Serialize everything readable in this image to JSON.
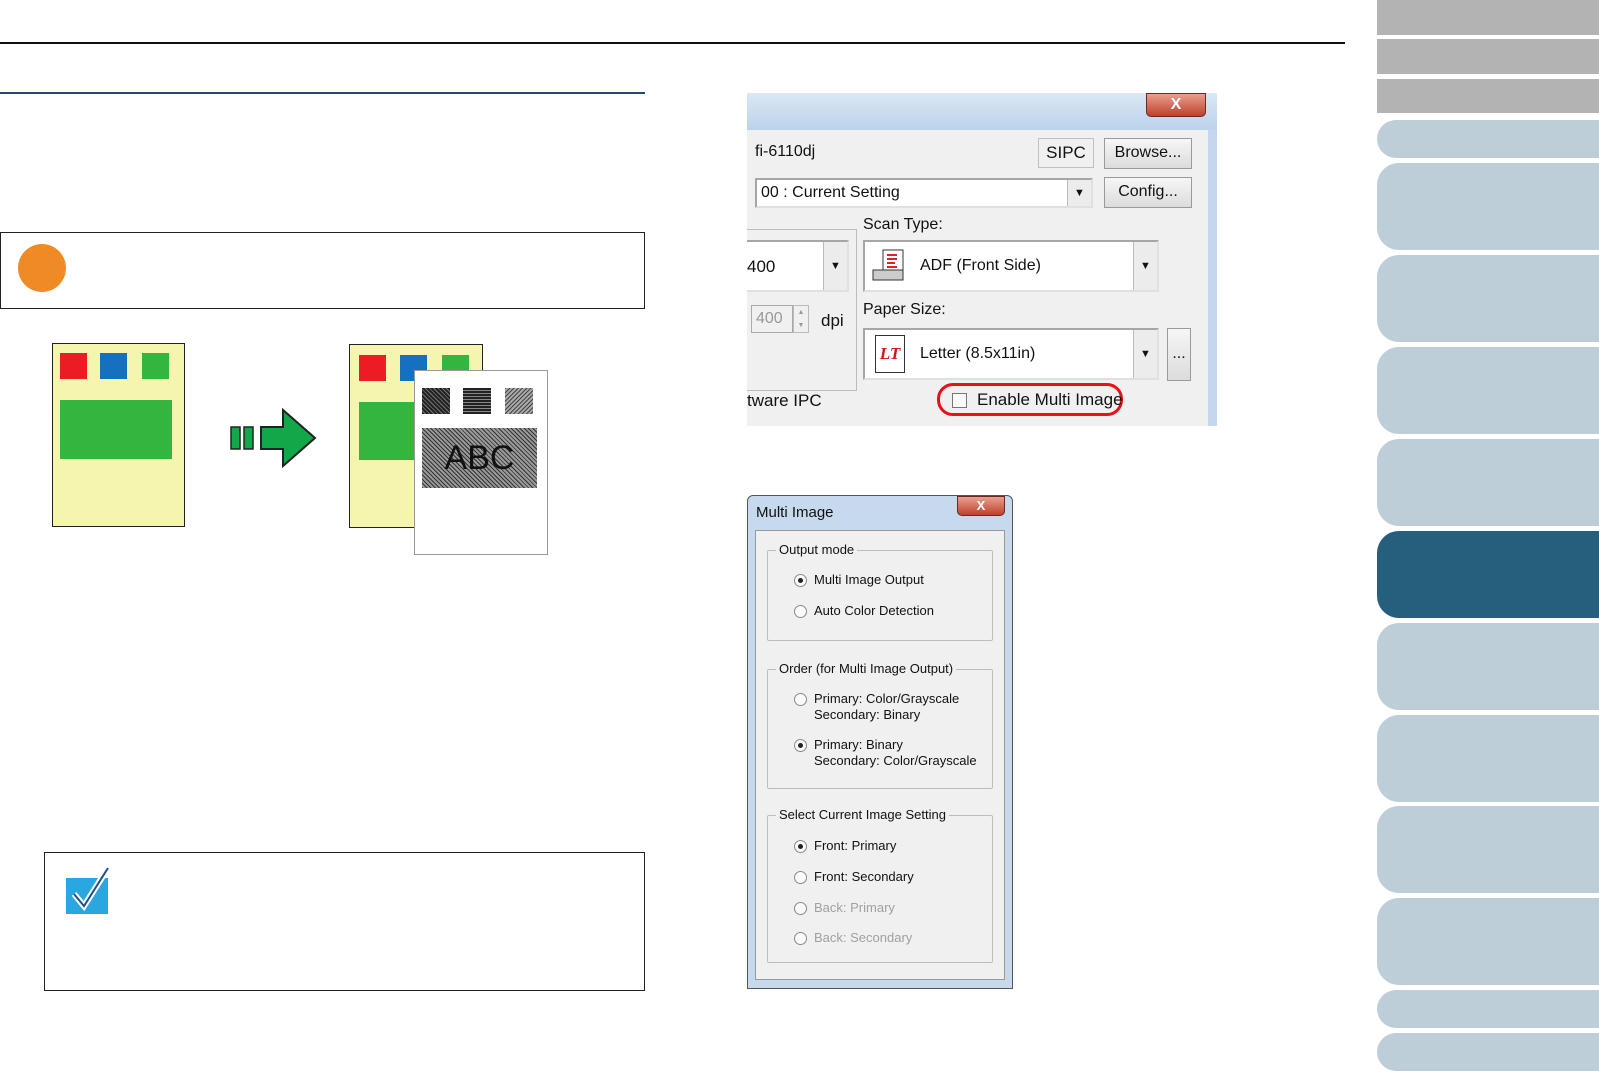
{
  "scanner_dialog": {
    "scanner_name": "fi-6110dj",
    "sipc_label": "SIPC",
    "browse_button": "Browse...",
    "profile_value": "00 : Current Setting",
    "config_button": "Config...",
    "resolution_value": "400",
    "custom_resolution_value": "400",
    "dpi_label": "dpi",
    "scan_type_label": "Scan Type:",
    "scan_type_value": "ADF (Front Side)",
    "paper_size_label": "Paper Size:",
    "paper_size_value": "Letter (8.5x11in)",
    "paper_icon_text": "LT",
    "more_button": "...",
    "software_label": "tware IPC",
    "enable_multi_image_label": "Enable Multi Image",
    "enable_multi_image_checked": false,
    "close_glyph": "X",
    "highlight_color": "#e8101a"
  },
  "multi_image_dialog": {
    "title": "Multi Image",
    "close_glyph": "X",
    "output_mode": {
      "legend": "Output mode",
      "options": [
        {
          "label": "Multi Image Output",
          "selected": true
        },
        {
          "label": "Auto Color Detection",
          "selected": false
        }
      ]
    },
    "order": {
      "legend": "Order (for Multi Image Output)",
      "options": [
        {
          "line1": "Primary: Color/Grayscale",
          "line2": "Secondary: Binary",
          "selected": false
        },
        {
          "line1": "Primary: Binary",
          "line2": "Secondary: Color/Grayscale",
          "selected": true
        }
      ]
    },
    "current_setting": {
      "legend": "Select Current Image Setting",
      "options": [
        {
          "label": "Front: Primary",
          "selected": true,
          "enabled": true
        },
        {
          "label": "Front: Secondary",
          "selected": false,
          "enabled": true
        },
        {
          "label": "Back: Primary",
          "selected": false,
          "enabled": false
        },
        {
          "label": "Back: Secondary",
          "selected": false,
          "enabled": false
        }
      ]
    }
  },
  "illustration": {
    "output_text": "ABC",
    "colors": {
      "red": "#ed1c24",
      "blue": "#1770bf",
      "green": "#33b540",
      "paper": "#f5f5b0",
      "arrow": "#12a84a"
    }
  },
  "colors": {
    "callout_dot": "#f08a24",
    "tab": "#bdced9",
    "tab_active": "#265e7e",
    "tab_gray": "#b3b3b3"
  }
}
